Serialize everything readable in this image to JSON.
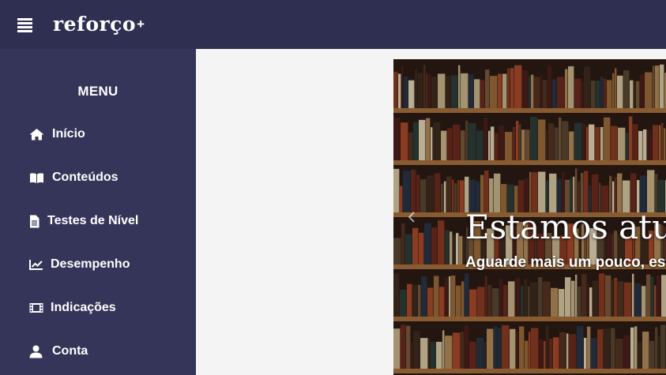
{
  "header": {
    "logo_text": "reforço",
    "logo_plus": "+",
    "menu_toggle_icon": "hamburger-icon",
    "background_color": "#2f2f52"
  },
  "sidebar": {
    "title": "MENU",
    "background_color": "#353559",
    "items": [
      {
        "label": "Início",
        "icon": "home-icon"
      },
      {
        "label": "Conteúdos",
        "icon": "book-icon"
      },
      {
        "label": "Testes de Nível",
        "icon": "document-icon"
      },
      {
        "label": "Desempenho",
        "icon": "chart-line-icon"
      },
      {
        "label": "Indicações",
        "icon": "film-icon"
      },
      {
        "label": "Conta",
        "icon": "user-icon"
      }
    ]
  },
  "carousel": {
    "title": "Estamos atualizando",
    "subtitle": "Aguarde mais um pouco, estamos preparando novidades",
    "prev_icon": "chevron-left-icon",
    "image": "bookshelf-photo"
  }
}
